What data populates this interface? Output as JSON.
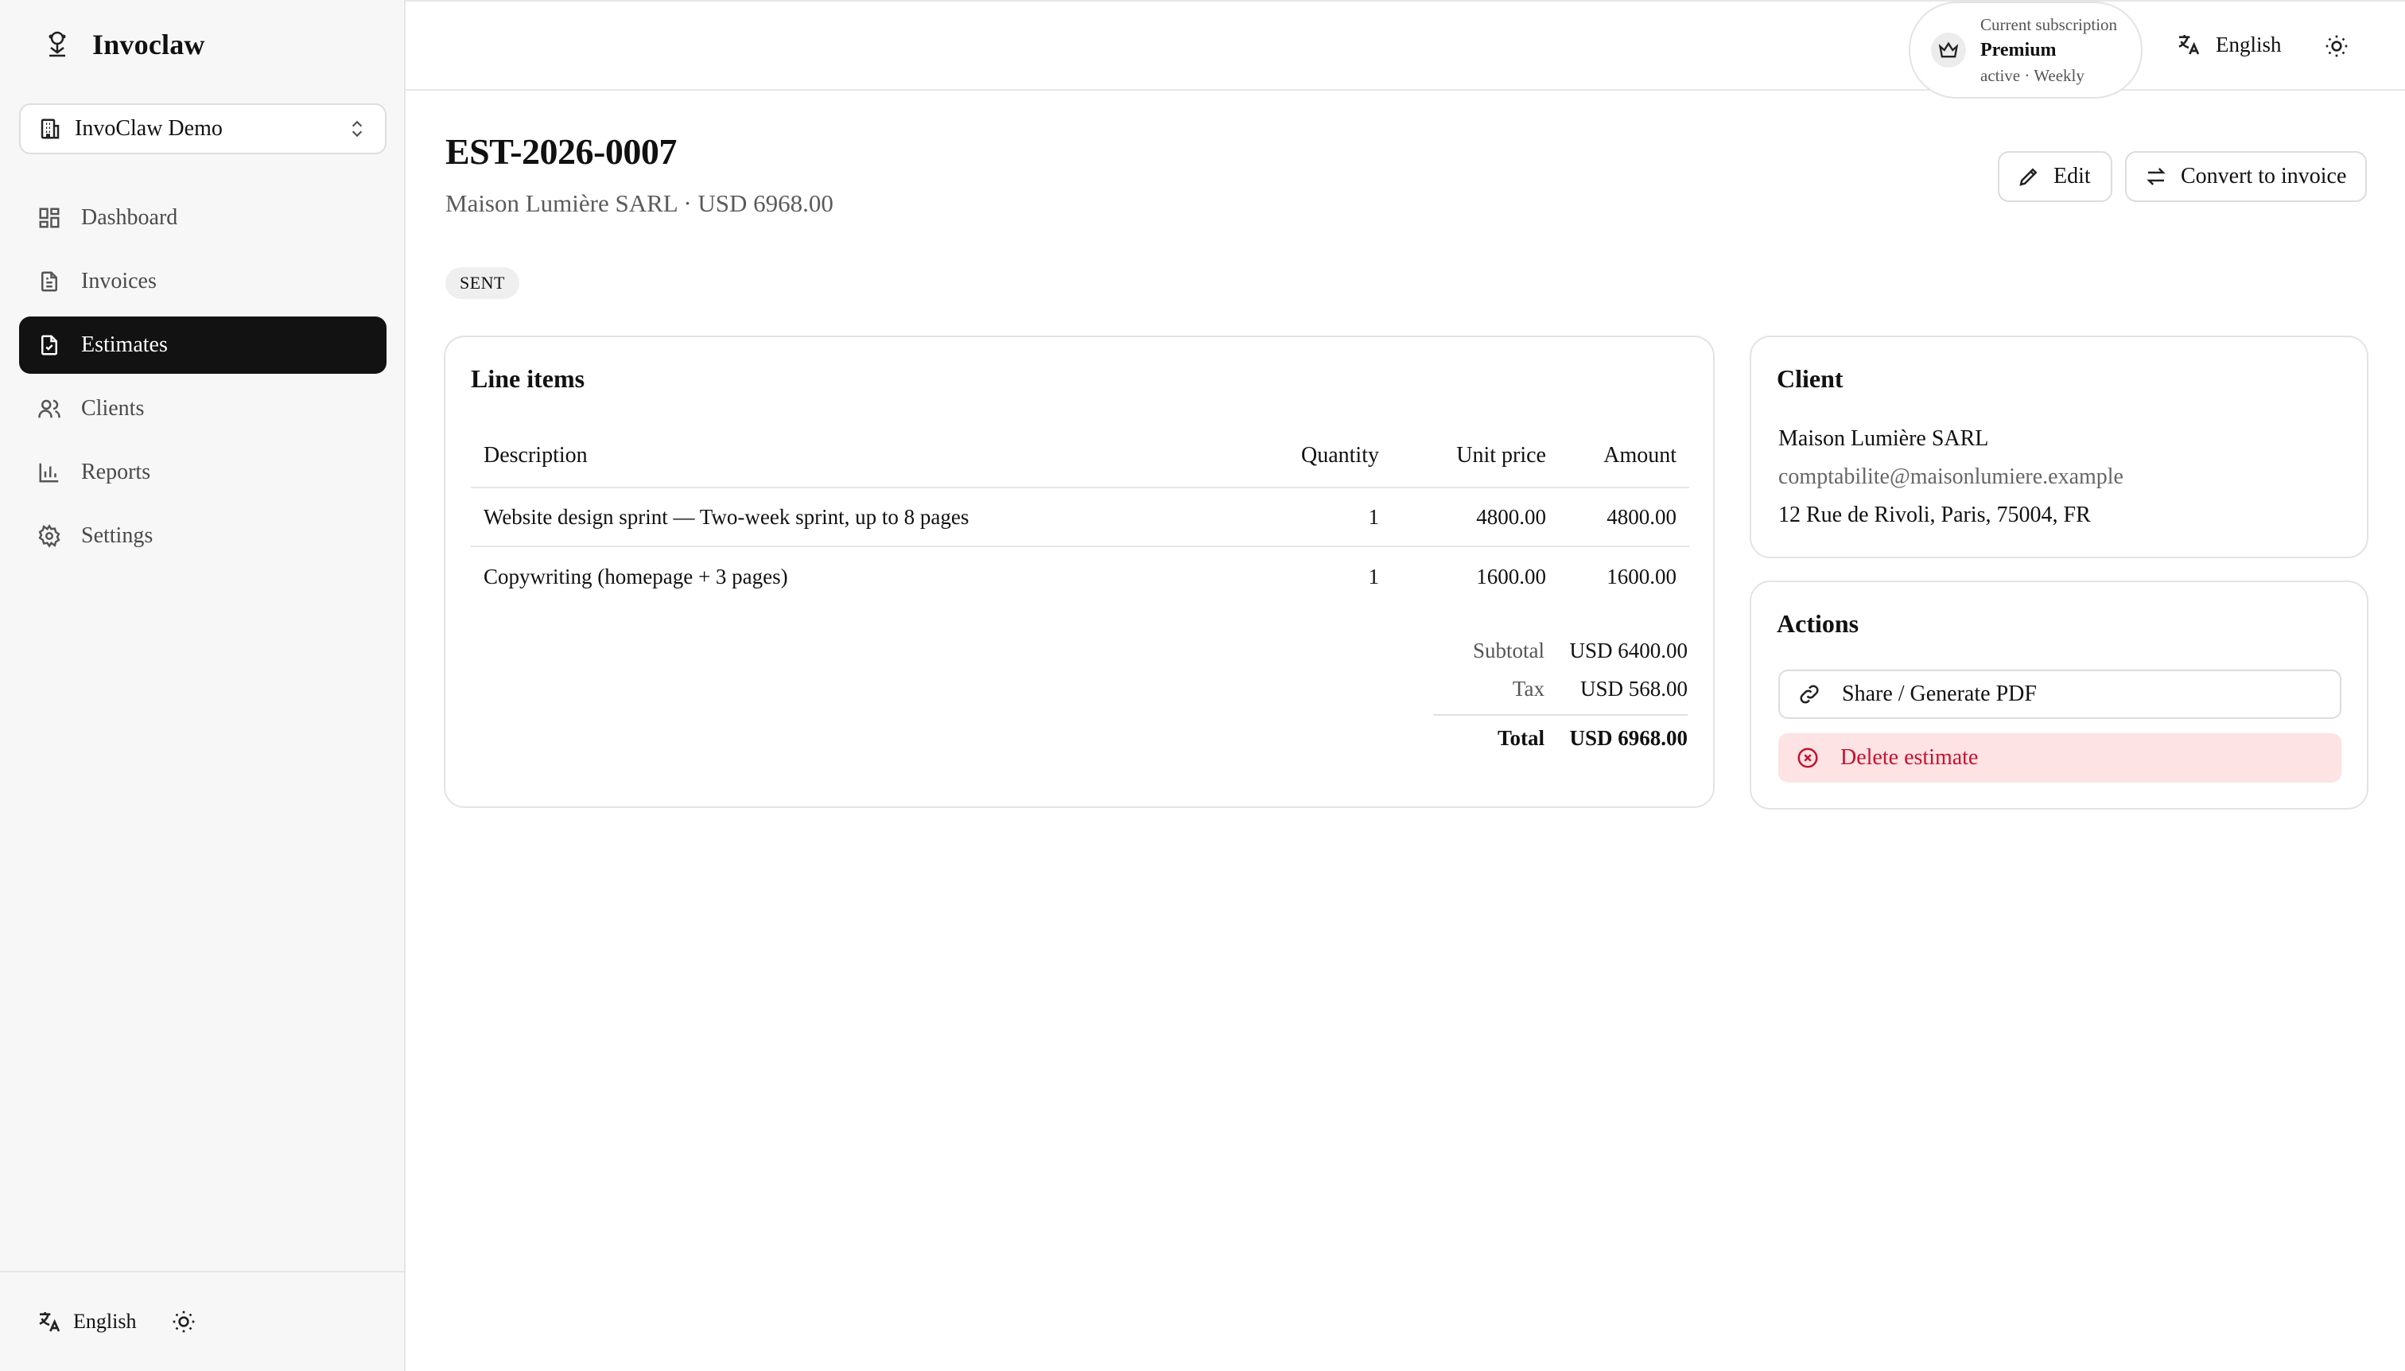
{
  "app": {
    "name": "Invoclaw"
  },
  "sidebar": {
    "org": "InvoClaw Demo",
    "items": [
      {
        "label": "Dashboard"
      },
      {
        "label": "Invoices"
      },
      {
        "label": "Estimates"
      },
      {
        "label": "Clients"
      },
      {
        "label": "Reports"
      },
      {
        "label": "Settings"
      }
    ],
    "footer_language": "English"
  },
  "topbar": {
    "subscription_label": "Current subscription",
    "plan": "Premium",
    "status": "active · Weekly",
    "language": "English"
  },
  "estimate": {
    "number": "EST-2026-0007",
    "subtitle": "Maison Lumière SARL · USD 6968.00",
    "status": "SENT",
    "edit_label": "Edit",
    "convert_label": "Convert to invoice"
  },
  "line_items": {
    "title": "Line items",
    "headers": {
      "description": "Description",
      "quantity": "Quantity",
      "unit_price": "Unit price",
      "amount": "Amount"
    },
    "rows": [
      {
        "description": "Website design sprint — Two-week sprint, up to 8 pages",
        "quantity": "1",
        "unit_price": "4800.00",
        "amount": "4800.00"
      },
      {
        "description": "Copywriting (homepage + 3 pages)",
        "quantity": "1",
        "unit_price": "1600.00",
        "amount": "1600.00"
      }
    ],
    "totals": {
      "subtotal_label": "Subtotal",
      "subtotal": "USD 6400.00",
      "tax_label": "Tax",
      "tax": "USD 568.00",
      "total_label": "Total",
      "total": "USD 6968.00"
    }
  },
  "client": {
    "title": "Client",
    "name": "Maison Lumière SARL",
    "email": "comptabilite@maisonlumiere.example",
    "address": "12 Rue de Rivoli, Paris, 75004, FR"
  },
  "actions": {
    "title": "Actions",
    "share_label": "Share / Generate PDF",
    "delete_label": "Delete estimate"
  },
  "colors": {
    "active_nav": "#121212",
    "danger": "#c8102e",
    "danger_bg": "#fde3e4"
  }
}
